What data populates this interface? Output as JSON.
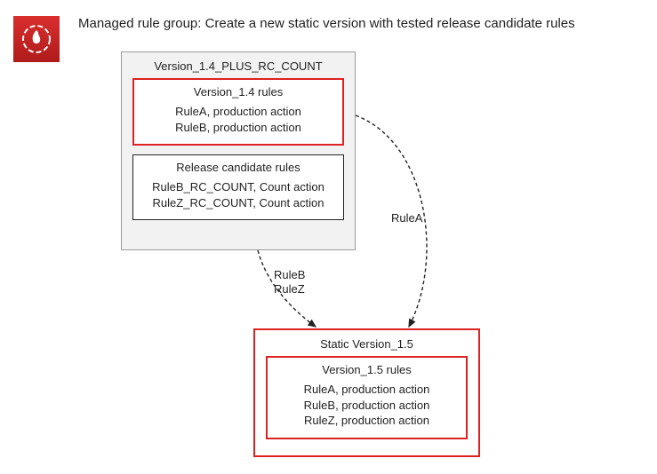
{
  "title": "Managed rule group: Create a new static version with tested release candidate rules",
  "icon": {
    "name": "aws-waf-icon"
  },
  "source_group": {
    "title": "Version_1.4_PLUS_RC_COUNT",
    "production": {
      "title": "Version_1.4 rules",
      "rule1": "RuleA, production action",
      "rule2": "RuleB, production action"
    },
    "candidate": {
      "title": "Release candidate rules",
      "rule1": "RuleB_RC_COUNT, Count action",
      "rule2": "RuleZ_RC_COUNT, Count action"
    }
  },
  "target_group": {
    "title": "Static Version_1.5",
    "rules_box": {
      "title": "Version_1.5 rules",
      "rule1": "RuleA, production action",
      "rule2": "RuleB, production action",
      "rule3": "RuleZ, production action"
    }
  },
  "arrow_labels": {
    "right": "RuleA",
    "left_line1": "RuleB",
    "left_line2": "RuleZ"
  }
}
